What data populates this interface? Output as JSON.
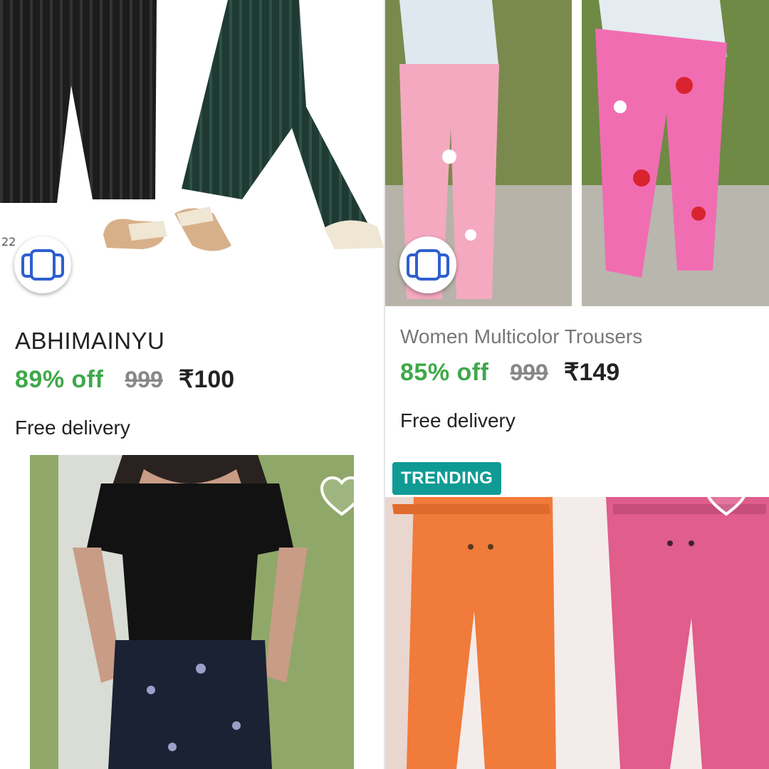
{
  "products": [
    {
      "brand": "ABHIMAINYU",
      "discount": "89% off",
      "mrp": "999",
      "price": "₹100",
      "delivery": "Free delivery",
      "image_icon": "similar-products-icon"
    },
    {
      "title": "Women Multicolor Trousers",
      "discount": "85% off",
      "mrp": "999",
      "price": "₹149",
      "delivery": "Free delivery",
      "image_icon": "similar-products-icon"
    },
    {
      "wishlist_icon": "heart-outline-icon"
    },
    {
      "badge": "TRENDING",
      "wishlist_icon": "heart-outline-icon"
    }
  ],
  "colors": {
    "discount_green": "#3ea84a",
    "trending_teal": "#0f9b94",
    "similar_icon_blue": "#2f5fd0"
  }
}
